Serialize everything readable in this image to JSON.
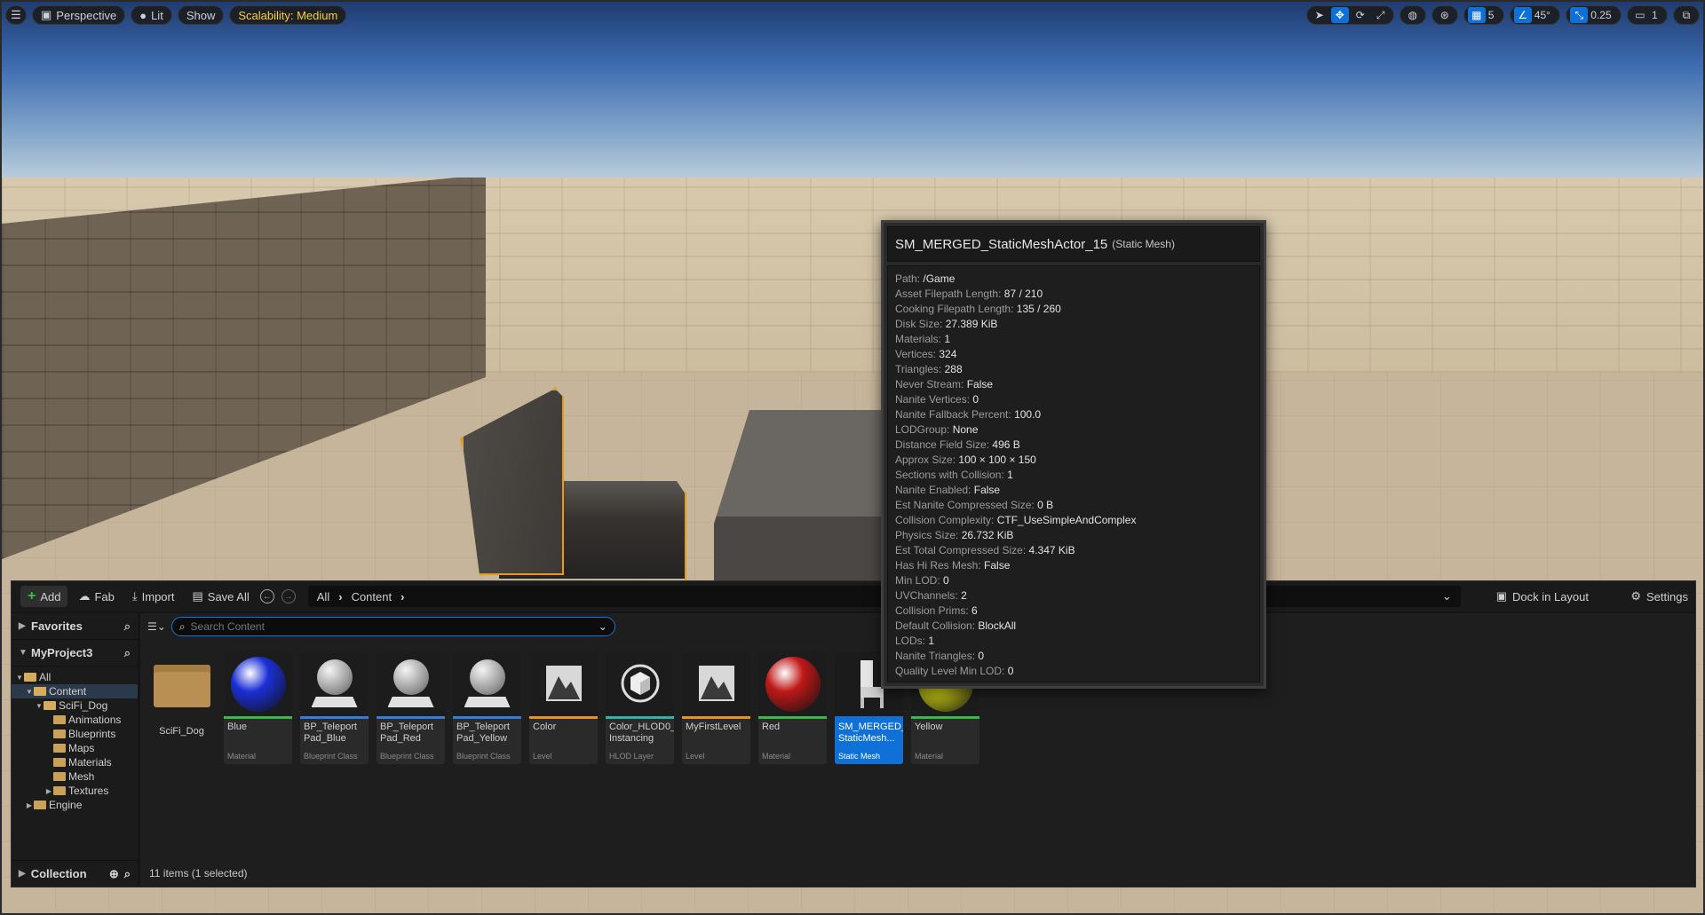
{
  "viewport_toolbar": {
    "view_mode": "Perspective",
    "lighting": "Lit",
    "show": "Show",
    "scalability": "Scalability: Medium",
    "grid_snap": "5",
    "rotation_snap": "45°",
    "scale_snap": "0.25",
    "camera_speed": "1"
  },
  "content_browser": {
    "toolbar": {
      "add": "Add",
      "fab": "Fab",
      "import": "Import",
      "save_all": "Save All",
      "dock_in_layout": "Dock in Layout",
      "settings": "Settings"
    },
    "breadcrumbs": [
      "All",
      "Content"
    ],
    "sidebar": {
      "favorites": "Favorites",
      "project": "MyProject3",
      "collection": "Collection",
      "tree": [
        {
          "label": "All",
          "depth": 0,
          "expanded": true
        },
        {
          "label": "Content",
          "depth": 1,
          "expanded": true,
          "selected": true
        },
        {
          "label": "SciFi_Dog",
          "depth": 2,
          "expanded": true
        },
        {
          "label": "Animations",
          "depth": 3
        },
        {
          "label": "Blueprints",
          "depth": 3
        },
        {
          "label": "Maps",
          "depth": 3
        },
        {
          "label": "Materials",
          "depth": 3
        },
        {
          "label": "Mesh",
          "depth": 3
        },
        {
          "label": "Textures",
          "depth": 3,
          "collapsed": true
        },
        {
          "label": "Engine",
          "depth": 1,
          "collapsed": true
        }
      ]
    },
    "search_placeholder": "Search Content",
    "assets": [
      {
        "name": "SciFi_Dog",
        "type": "",
        "kind": "folder"
      },
      {
        "name": "Blue",
        "type": "Material",
        "kind": "sphere",
        "color": "#1b2fd6",
        "stripe": "#3cb84a"
      },
      {
        "name": "BP_Teleport Pad_Blue",
        "type": "Blueprint Class",
        "kind": "bp",
        "stripe": "#3a7bd5"
      },
      {
        "name": "BP_Teleport Pad_Red",
        "type": "Blueprint Class",
        "kind": "bp",
        "stripe": "#3a7bd5"
      },
      {
        "name": "BP_Teleport Pad_Yellow",
        "type": "Blueprint Class",
        "kind": "bp",
        "stripe": "#3a7bd5"
      },
      {
        "name": "Color",
        "type": "Level",
        "kind": "level",
        "stripe": "#e6941a"
      },
      {
        "name": "Color_HLOD0_ Instancing",
        "type": "HLOD Layer",
        "kind": "hlod",
        "stripe": "#2db3a8"
      },
      {
        "name": "MyFirstLevel",
        "type": "Level",
        "kind": "level",
        "stripe": "#e6941a"
      },
      {
        "name": "Red",
        "type": "Material",
        "kind": "sphere",
        "color": "#c01818",
        "stripe": "#3cb84a"
      },
      {
        "name": "SM_MERGED_ StaticMesh...",
        "type": "Static Mesh",
        "kind": "mesh",
        "stripe": "#0f70d7",
        "selected": true
      },
      {
        "name": "Yellow",
        "type": "Material",
        "kind": "sphere",
        "color": "#c8c814",
        "stripe": "#3cb84a"
      }
    ],
    "status": "11 items (1 selected)"
  },
  "tooltip": {
    "title": "SM_MERGED_StaticMeshActor_15",
    "subtitle": "(Static Mesh)",
    "rows": [
      {
        "k": "Path:",
        "v": "/Game"
      },
      {
        "k": "Asset Filepath Length:",
        "v": "87 / 210"
      },
      {
        "k": "Cooking Filepath Length:",
        "v": "135 / 260"
      },
      {
        "k": "Disk Size:",
        "v": "27.389 KiB"
      },
      {
        "k": "Materials:",
        "v": "1"
      },
      {
        "k": "Vertices:",
        "v": "324"
      },
      {
        "k": "Triangles:",
        "v": "288"
      },
      {
        "k": "Never Stream:",
        "v": "False"
      },
      {
        "k": "Nanite Vertices:",
        "v": "0"
      },
      {
        "k": "Nanite Fallback Percent:",
        "v": "100.0"
      },
      {
        "k": "LODGroup:",
        "v": "None"
      },
      {
        "k": "Distance Field Size:",
        "v": "496 B"
      },
      {
        "k": "Approx Size:",
        "v": "100 × 100 × 150"
      },
      {
        "k": "Sections with Collision:",
        "v": "1"
      },
      {
        "k": "Nanite Enabled:",
        "v": "False"
      },
      {
        "k": "Est Nanite Compressed Size:",
        "v": "0 B"
      },
      {
        "k": "Collision Complexity:",
        "v": "CTF_UseSimpleAndComplex"
      },
      {
        "k": "Physics Size:",
        "v": "26.732 KiB"
      },
      {
        "k": "Est Total Compressed Size:",
        "v": "4.347 KiB"
      },
      {
        "k": "Has Hi Res Mesh:",
        "v": "False"
      },
      {
        "k": "Min LOD:",
        "v": "0"
      },
      {
        "k": "UVChannels:",
        "v": "2"
      },
      {
        "k": "Collision Prims:",
        "v": "6"
      },
      {
        "k": "Default Collision:",
        "v": "BlockAll"
      },
      {
        "k": "LODs:",
        "v": "1"
      },
      {
        "k": "Nanite Triangles:",
        "v": "0"
      },
      {
        "k": "Quality Level Min LOD:",
        "v": "0"
      }
    ]
  }
}
